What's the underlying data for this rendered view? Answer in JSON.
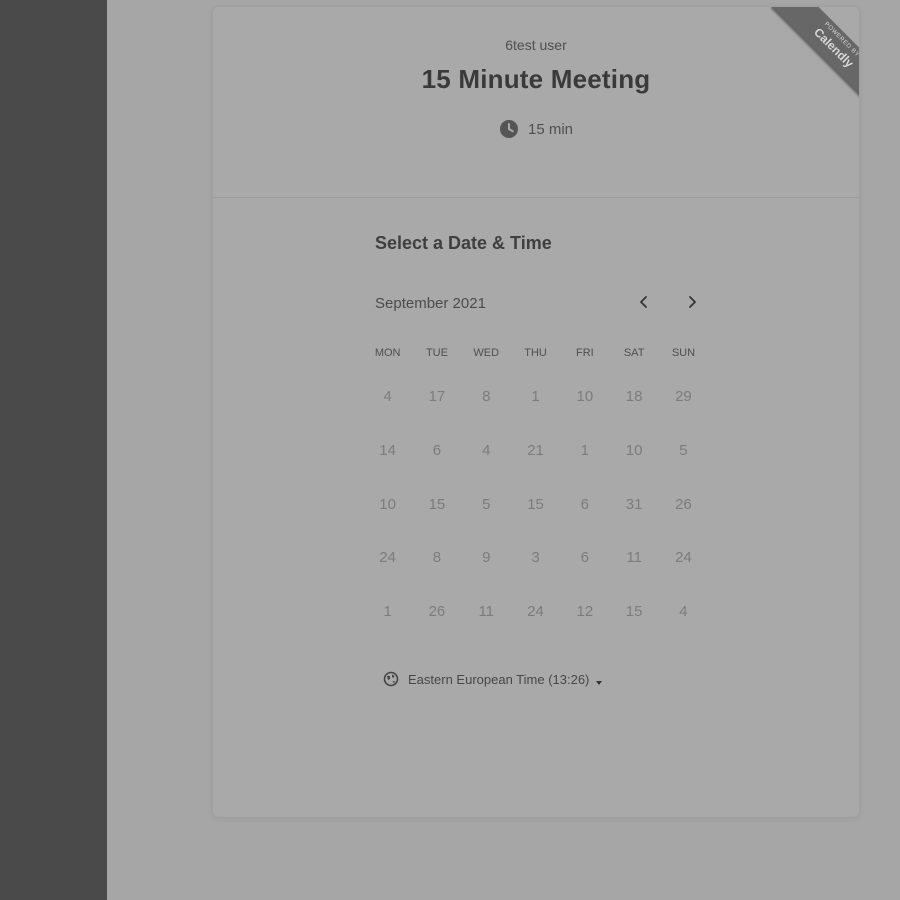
{
  "event": {
    "owner": "6test user",
    "title": "15 Minute Meeting",
    "duration": "15 min",
    "duration_icon": "clock-icon"
  },
  "branding": {
    "top_text": "POWERED BY",
    "brand": "Calendly"
  },
  "picker": {
    "heading": "Select a Date & Time",
    "month": "September 2021",
    "prev_icon": "chevron-left-icon",
    "next_icon": "chevron-right-icon",
    "weekdays": [
      "MON",
      "TUE",
      "WED",
      "THU",
      "FRI",
      "SAT",
      "SUN"
    ],
    "days": [
      [
        "4",
        "17",
        "8",
        "1",
        "10",
        "18",
        "29"
      ],
      [
        "14",
        "6",
        "4",
        "21",
        "1",
        "10",
        "5"
      ],
      [
        "10",
        "15",
        "5",
        "15",
        "6",
        "31",
        "26"
      ],
      [
        "24",
        "8",
        "9",
        "3",
        "6",
        "11",
        "24"
      ],
      [
        "1",
        "26",
        "11",
        "24",
        "12",
        "15",
        "4"
      ]
    ]
  },
  "timezone": {
    "label": "Eastern European Time (13:26)",
    "icon": "globe-icon",
    "dropdown_icon": "caret-down-icon"
  },
  "colors": {
    "page_background": "#a6a6a6",
    "sidebar": "#4a4a4a",
    "ribbon": "#676767",
    "day_text": "#7c7c7c"
  }
}
